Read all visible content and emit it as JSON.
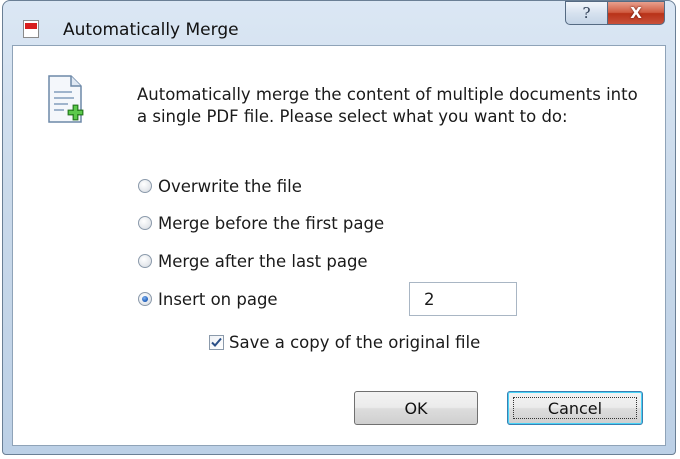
{
  "window": {
    "title": "Automatically Merge",
    "help_label": "?",
    "close_label": "X"
  },
  "dialog": {
    "message": "Automatically merge the content of multiple documents into a single PDF file. Please select what you want to do:",
    "options": [
      {
        "label": "Overwrite the file",
        "checked": false
      },
      {
        "label": "Merge before the first page",
        "checked": false
      },
      {
        "label": "Merge after the last page",
        "checked": false
      },
      {
        "label": "Insert on page",
        "checked": true
      }
    ],
    "page_value": "2",
    "save_copy": {
      "label": "Save a copy of the original file",
      "checked": true
    },
    "ok_label": "OK",
    "cancel_label": "Cancel"
  },
  "icons": {
    "app": "pdf-document-icon",
    "doc": "document-add-icon"
  }
}
